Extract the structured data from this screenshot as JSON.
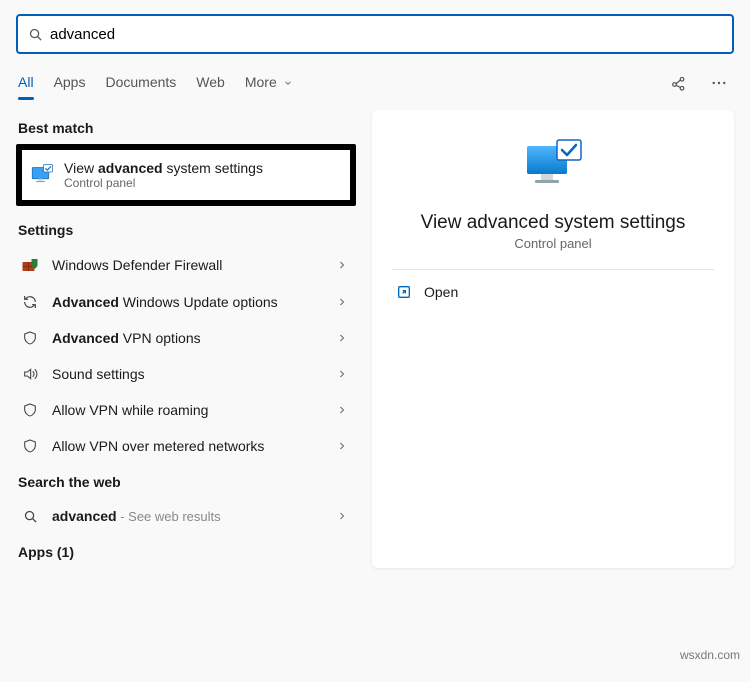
{
  "search": {
    "value": "advanced"
  },
  "tabs": {
    "all": "All",
    "apps": "Apps",
    "documents": "Documents",
    "web": "Web",
    "more": "More"
  },
  "sections": {
    "best_match": "Best match",
    "settings": "Settings",
    "search_web": "Search the web",
    "apps": "Apps (1)"
  },
  "best_match": {
    "pre": "View ",
    "bold": "advanced",
    "post": " system settings",
    "sub": "Control panel"
  },
  "settings_items": [
    {
      "pre": "Windows Defender Firewall",
      "bold": "",
      "post": ""
    },
    {
      "pre": "",
      "bold": "Advanced",
      "post": " Windows Update options"
    },
    {
      "pre": "",
      "bold": "Advanced",
      "post": " VPN options"
    },
    {
      "pre": "Sound settings",
      "bold": "",
      "post": ""
    },
    {
      "pre": "Allow VPN while roaming",
      "bold": "",
      "post": ""
    },
    {
      "pre": "Allow VPN over metered networks",
      "bold": "",
      "post": ""
    }
  ],
  "web_item": {
    "bold": "advanced",
    "suffix": " - See web results"
  },
  "preview": {
    "title": "View advanced system settings",
    "sub": "Control panel",
    "open": "Open"
  },
  "watermark": "wsxdn.com"
}
